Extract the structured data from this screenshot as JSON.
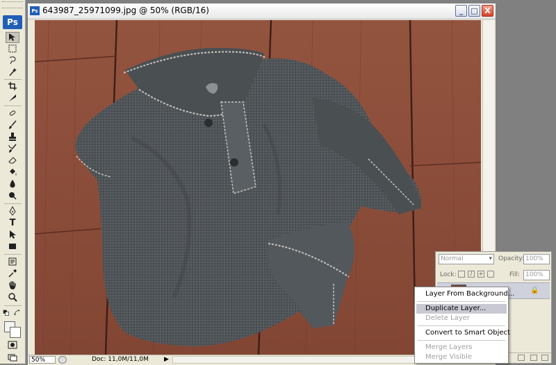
{
  "app": {
    "logo": "Ps"
  },
  "document": {
    "title": "643987_25971099.jpg @ 50% (RGB/16)",
    "title_icon": "Ps",
    "window_buttons": {
      "minimize": "_",
      "maximize": "□",
      "close": "X"
    }
  },
  "status": {
    "zoom": "50%",
    "doc_size": "Doc: 11,0M/11,0M",
    "arrow": "▶"
  },
  "toolbox": {
    "tools": [
      "move-tool",
      "marquee-tool",
      "lasso-tool",
      "magic-wand-tool",
      "crop-tool",
      "slice-tool",
      "healing-brush-tool",
      "brush-tool",
      "clone-stamp-tool",
      "history-brush-tool",
      "eraser-tool",
      "paint-bucket-tool",
      "blur-tool",
      "dodge-tool",
      "pen-tool",
      "type-tool",
      "path-selection-tool",
      "rectangle-tool",
      "notes-tool",
      "eyedropper-tool",
      "hand-tool",
      "zoom-tool"
    ],
    "type_tool_label": "T"
  },
  "layers_panel": {
    "blend_mode": "Normal",
    "opacity_label": "Opacity:",
    "opacity_value": "100%",
    "lock_label": "Lock:",
    "fill_label": "Fill:",
    "fill_value": "100%"
  },
  "context_menu": {
    "items": [
      {
        "label": "Layer From Background...",
        "enabled": true
      },
      {
        "label": "Duplicate Layer...",
        "enabled": true,
        "highlighted": true
      },
      {
        "label": "Delete Layer",
        "enabled": false
      },
      {
        "label": "Convert to Smart Object",
        "enabled": true
      },
      {
        "label": "Merge Layers",
        "enabled": false
      },
      {
        "label": "Merge Visible",
        "enabled": false
      }
    ]
  },
  "colors": {
    "accent": "#1f5fb7",
    "wood": "#8a4b3a",
    "shirt": "#4f5457",
    "stitching": "#c9c6bf"
  }
}
